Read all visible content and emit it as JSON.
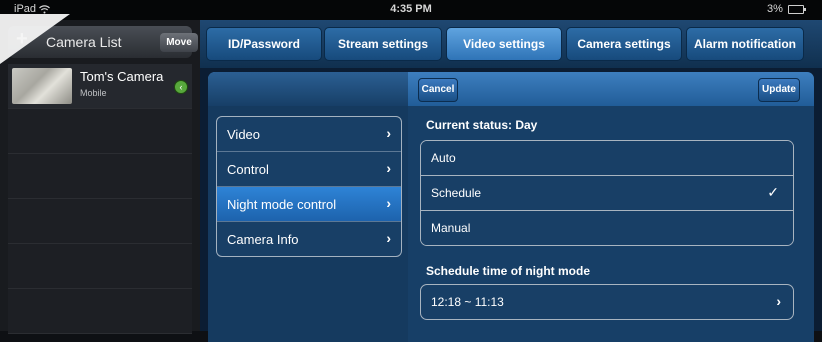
{
  "status_bar": {
    "device": "iPad",
    "time": "4:35 PM",
    "battery": "3%"
  },
  "sidebar": {
    "title": "Camera List",
    "move_label": "Move",
    "cameras": [
      {
        "name": "Tom's Camera",
        "subtitle": "Mobile"
      }
    ]
  },
  "tabs": [
    {
      "label": "ID/Password"
    },
    {
      "label": "Stream settings"
    },
    {
      "label": "Video settings"
    },
    {
      "label": "Camera settings"
    },
    {
      "label": "Alarm notification"
    }
  ],
  "toolbar": {
    "cancel_label": "Cancel",
    "update_label": "Update"
  },
  "menu": {
    "items": [
      {
        "label": "Video"
      },
      {
        "label": "Control"
      },
      {
        "label": "Night mode control"
      },
      {
        "label": "Camera Info"
      }
    ]
  },
  "detail": {
    "current_status": "Current status: Day",
    "modes": [
      {
        "label": "Auto"
      },
      {
        "label": "Schedule"
      },
      {
        "label": "Manual"
      }
    ],
    "schedule_heading": "Schedule time of night mode",
    "schedule_time": "12:18 ~ 11:13"
  },
  "icons": {
    "check": "checkmark-icon",
    "chevron": "chevron-right-icon",
    "add": "plus-icon",
    "wifi": "wifi-icon",
    "battery": "battery-icon",
    "camera_status": "camera-status-icon"
  },
  "colors": {
    "accent": "#2e83d6",
    "tab_active": "#5fa3df",
    "status_ok": "#58a83c"
  }
}
